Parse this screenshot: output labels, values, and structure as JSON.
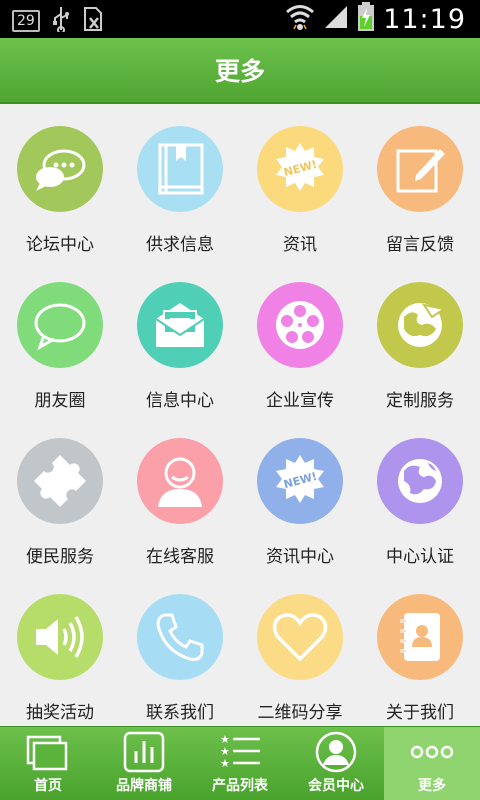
{
  "status_bar": {
    "badge": "29",
    "time": "11:19"
  },
  "header": {
    "title": "更多"
  },
  "tiles": [
    {
      "label": "论坛中心",
      "icon": "chat-bubbles-icon",
      "color": "#a2c85c"
    },
    {
      "label": "供求信息",
      "icon": "book-icon",
      "color": "#a9dff3"
    },
    {
      "label": "资讯",
      "icon": "new-badge-icon",
      "color": "#fbd97d"
    },
    {
      "label": "留言反馈",
      "icon": "edit-note-icon",
      "color": "#f8b97d"
    },
    {
      "label": "朋友圈",
      "icon": "speech-bubble-icon",
      "color": "#80dc7a"
    },
    {
      "label": "信息中心",
      "icon": "envelope-icon",
      "color": "#4fd0b6"
    },
    {
      "label": "企业宣传",
      "icon": "film-reel-icon",
      "color": "#ef82e4"
    },
    {
      "label": "定制服务",
      "icon": "globe-arrow-icon",
      "color": "#c2c84c"
    },
    {
      "label": "便民服务",
      "icon": "puzzle-icon",
      "color": "#c1c6cb"
    },
    {
      "label": "在线客服",
      "icon": "person-icon",
      "color": "#fb9fa8"
    },
    {
      "label": "资讯中心",
      "icon": "new-badge-icon",
      "color": "#8fb0e9"
    },
    {
      "label": "中心认证",
      "icon": "globe-icon",
      "color": "#ae94ed"
    },
    {
      "label": "抽奖活动",
      "icon": "speaker-icon",
      "color": "#b6dc6a"
    },
    {
      "label": "联系我们",
      "icon": "phone-icon",
      "color": "#a7dcf5"
    },
    {
      "label": "二维码分享",
      "icon": "heart-icon",
      "color": "#fbdb85"
    },
    {
      "label": "关于我们",
      "icon": "contacts-book-icon",
      "color": "#f8ba7c"
    }
  ],
  "nav": [
    {
      "label": "首页",
      "icon": "home-windows-icon"
    },
    {
      "label": "品牌商铺",
      "icon": "bar-chart-icon"
    },
    {
      "label": "产品列表",
      "icon": "star-list-icon"
    },
    {
      "label": "会员中心",
      "icon": "member-icon"
    },
    {
      "label": "更多",
      "icon": "more-dots-icon",
      "active": true
    }
  ]
}
